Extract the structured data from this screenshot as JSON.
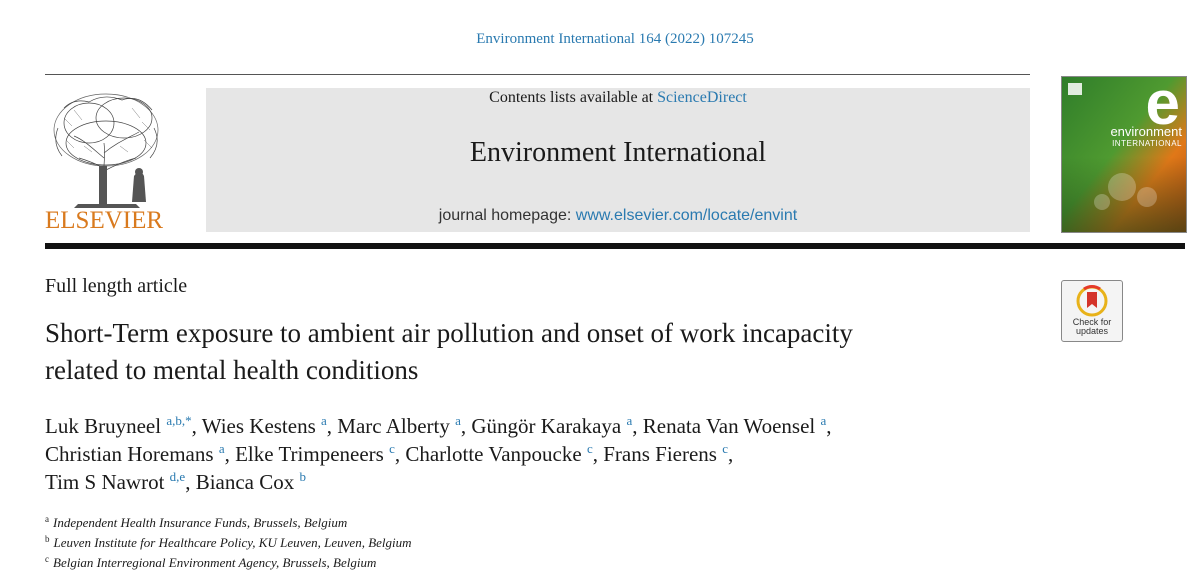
{
  "header": {
    "citation": "Environment International 164 (2022) 107245",
    "contents_prefix": "Contents lists available at ",
    "contents_link": "ScienceDirect",
    "journal_name": "Environment International",
    "homepage_prefix": "journal homepage: ",
    "homepage_link": "www.elsevier.com/locate/envint",
    "publisher": "ELSEVIER"
  },
  "cover": {
    "letter": "e",
    "title": "environment",
    "subtitle": "INTERNATIONAL",
    "colors": {
      "green": "#3a8a2e",
      "orange": "#e07818",
      "dark": "#1e4a1a"
    }
  },
  "check_badge": {
    "line1": "Check for",
    "line2": "updates"
  },
  "article": {
    "type": "Full length article",
    "title_line1": "Short-Term exposure to ambient air pollution and onset of work incapacity",
    "title_line2": "related to mental health conditions"
  },
  "authors": [
    {
      "name": "Luk Bruyneel",
      "sup": "a,b,*",
      "sep": ", "
    },
    {
      "name": "Wies Kestens",
      "sup": "a",
      "sep": ", "
    },
    {
      "name": "Marc Alberty",
      "sup": "a",
      "sep": ", "
    },
    {
      "name": "Güngör Karakaya",
      "sup": "a",
      "sep": ", "
    },
    {
      "name": "Renata Van Woensel",
      "sup": "a",
      "sep": ", "
    },
    {
      "name": "Christian Horemans",
      "sup": "a",
      "sep": ", "
    },
    {
      "name": "Elke Trimpeneers",
      "sup": "c",
      "sep": ", "
    },
    {
      "name": "Charlotte Vanpoucke",
      "sup": "c",
      "sep": ", "
    },
    {
      "name": "Frans Fierens",
      "sup": "c",
      "sep": ", "
    },
    {
      "name": "Tim S Nawrot",
      "sup": "d,e",
      "sep": ", "
    },
    {
      "name": "Bianca Cox",
      "sup": "b",
      "sep": ""
    }
  ],
  "affiliations": [
    {
      "key": "a",
      "text": "Independent Health Insurance Funds, Brussels, Belgium"
    },
    {
      "key": "b",
      "text": "Leuven Institute for Healthcare Policy, KU Leuven, Leuven, Belgium"
    },
    {
      "key": "c",
      "text": "Belgian Interregional Environment Agency, Brussels, Belgium"
    }
  ],
  "colors": {
    "link": "#2a7ab0",
    "publisher_orange": "#d97a1e",
    "header_bg": "#e6e6e6"
  }
}
